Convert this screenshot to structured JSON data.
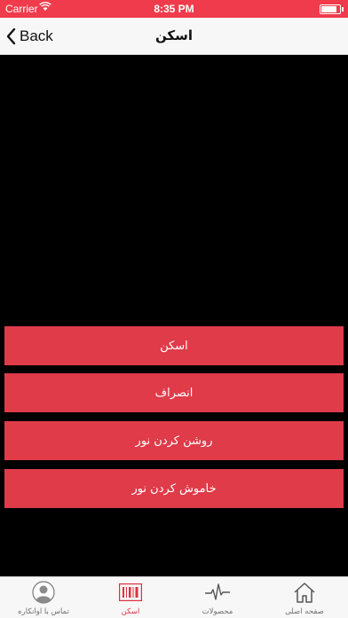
{
  "status_bar": {
    "carrier": "Carrier",
    "time": "8:35 PM"
  },
  "nav": {
    "back_label": "Back",
    "title": "اسکن"
  },
  "actions": {
    "scan": "اسکن",
    "cancel": "انصراف",
    "light_on": "روشن کردن نور",
    "light_off": "خاموش کردن نور"
  },
  "tabs": [
    {
      "label": "تماس با اوانکاره",
      "icon": "user-circle-icon",
      "active": false
    },
    {
      "label": "اسکن",
      "icon": "barcode-icon",
      "active": true
    },
    {
      "label": "محصولات",
      "icon": "pulse-icon",
      "active": false
    },
    {
      "label": "صفحه اصلی",
      "icon": "home-icon",
      "active": false
    }
  ],
  "colors": {
    "accent": "#df3b49",
    "status_bar": "#ef3b4b",
    "tab_active": "#e0303e"
  }
}
